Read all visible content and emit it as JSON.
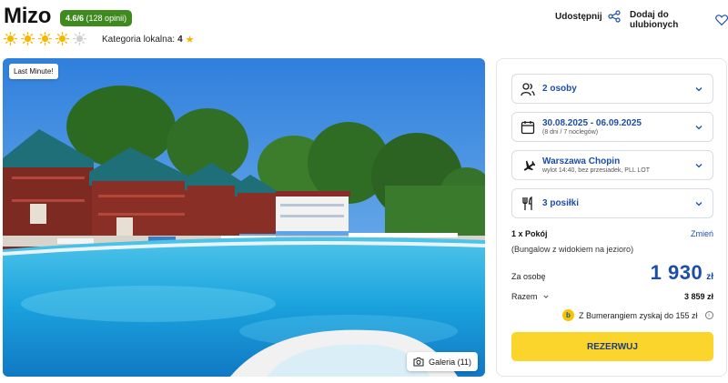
{
  "hotel": {
    "name": "Mizo",
    "rating_score": "4.6/6",
    "rating_count": "(128 opinii)",
    "sun_rating": 4,
    "sun_max": 5,
    "local_category_label": "Kategoria lokalna:",
    "local_category_value": "4"
  },
  "actions": {
    "share_label": "Udostępnij",
    "favorite_label": "Dodaj do ulubionych"
  },
  "photo": {
    "badge": "Last Minute!",
    "gallery_label": "Galeria (11)"
  },
  "booking": {
    "guests": "2 osoby",
    "dates": "30.08.2025 - 06.09.2025",
    "dates_sub": "(8 dni / 7 noclegów)",
    "departure": "Warszawa Chopin",
    "departure_sub": "wylot 14:40, bez przesiadek, PLL LOT",
    "meals": "3 posiłki",
    "room": "1 x Pokój",
    "change_label": "Zmień",
    "room_desc": "(Bungalow z widokiem na jezioro)",
    "per_person_label": "Za osobę",
    "price_per_person": "1 930",
    "currency": "zł",
    "total_label": "Razem",
    "total_value": "3 859 zł",
    "bumerang_text": "Z Bumerangiem zyskaj do 155 zł",
    "reserve_label": "REZERWUJ"
  },
  "colors": {
    "brand_blue": "#1c4ea8",
    "rating_green": "#3f8a1f",
    "cta_yellow": "#fbd52c",
    "sun_yellow": "#f7b500"
  }
}
